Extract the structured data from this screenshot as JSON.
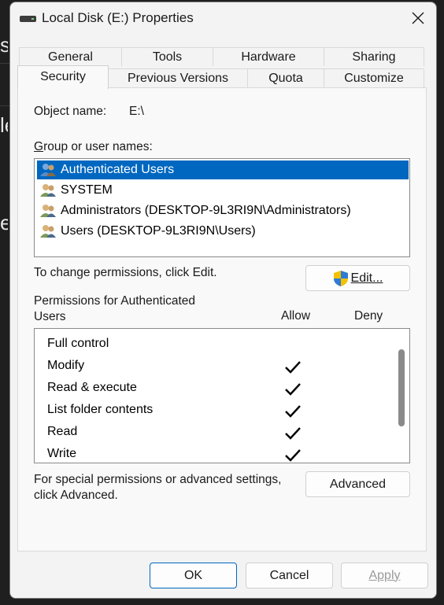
{
  "window": {
    "title": "Local Disk (E:) Properties"
  },
  "tabs": {
    "row1": [
      "General",
      "Tools",
      "Hardware",
      "Sharing"
    ],
    "row2": [
      "Security",
      "Previous Versions",
      "Quota",
      "Customize"
    ],
    "active": "Security"
  },
  "security": {
    "object_name_label": "Object name:",
    "object_name_value": "E:\\",
    "group_label": "Group or user names:",
    "groups": [
      {
        "name": "Authenticated Users",
        "selected": true
      },
      {
        "name": "SYSTEM",
        "selected": false
      },
      {
        "name": "Administrators (DESKTOP-9L3RI9N\\Administrators)",
        "selected": false
      },
      {
        "name": "Users (DESKTOP-9L3RI9N\\Users)",
        "selected": false
      }
    ],
    "change_text": "To change permissions, click Edit.",
    "edit_button": "Edit...",
    "permissions_label_line1": "Permissions for Authenticated",
    "permissions_label_line2": "Users",
    "allow_header": "Allow",
    "deny_header": "Deny",
    "permissions": [
      {
        "name": "Full control",
        "allow": false,
        "deny": false
      },
      {
        "name": "Modify",
        "allow": true,
        "deny": false
      },
      {
        "name": "Read & execute",
        "allow": true,
        "deny": false
      },
      {
        "name": "List folder contents",
        "allow": true,
        "deny": false
      },
      {
        "name": "Read",
        "allow": true,
        "deny": false
      },
      {
        "name": "Write",
        "allow": true,
        "deny": false
      }
    ],
    "special_text_line1": "For special permissions or advanced settings,",
    "special_text_line2": "click Advanced.",
    "advanced_button": "Advanced"
  },
  "footer": {
    "ok": "OK",
    "cancel": "Cancel",
    "apply": "Apply"
  },
  "background": {
    "frag1": "s",
    "frag2": "le",
    "frag3": "e"
  },
  "colors": {
    "selection": "#0067c0",
    "window_bg": "#f3f3f3",
    "panel_bg": "#f9f9f9"
  },
  "icons": {
    "title": "drive-icon",
    "close": "close-icon",
    "user": "users-icon",
    "shield": "uac-shield-icon",
    "check": "checkmark-icon"
  }
}
